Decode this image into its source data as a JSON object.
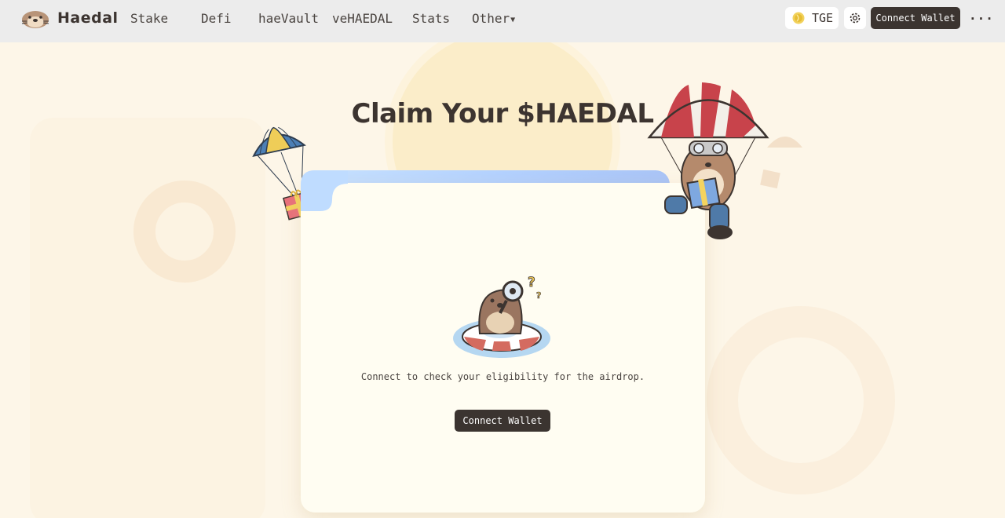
{
  "brand": {
    "name": "Haedal"
  },
  "nav": {
    "items": [
      "Stake",
      "Defi",
      "haeVault",
      "veHAEDAL",
      "Stats"
    ],
    "other_label": "Other",
    "tge_label": "TGE",
    "connect_wallet": "Connect Wallet",
    "more_label": "···"
  },
  "main": {
    "title": "Claim Your $HAEDAL",
    "message": "Connect to check your eligibility for the airdrop.",
    "connect_wallet": "Connect Wallet"
  },
  "icons": {
    "logo": "otter-logo-icon",
    "tge": "coin-icon",
    "settings": "gear-icon",
    "more": "more-dots-icon"
  },
  "colors": {
    "background": "#fdf6e8",
    "header": "#ececec",
    "button_dark": "#3b3430",
    "card": "#fffdf2",
    "tab_gradient_start": "#c8e2ff",
    "tab_gradient_end": "#a9c4f7"
  }
}
